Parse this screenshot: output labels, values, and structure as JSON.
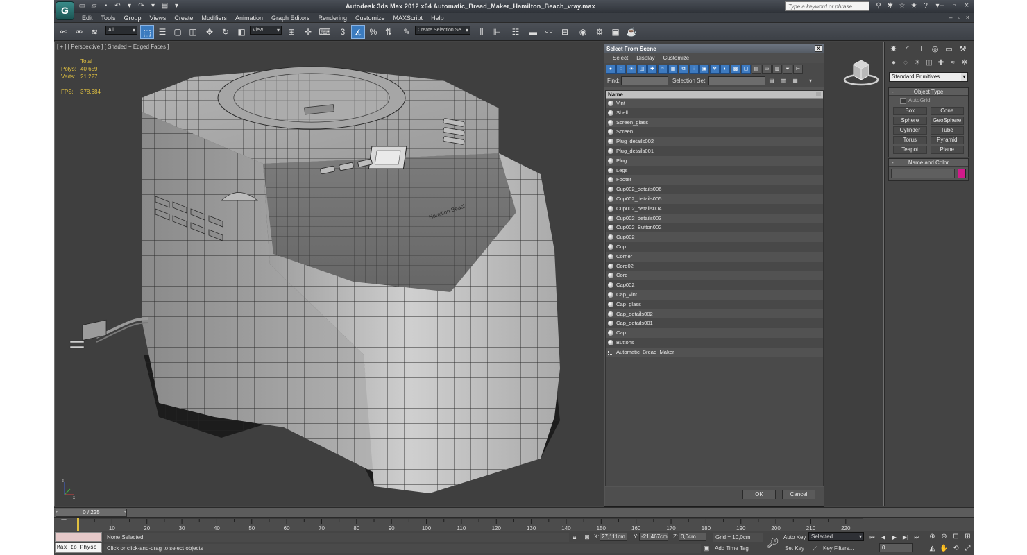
{
  "window": {
    "app_logo": "G",
    "title": "Autodesk 3ds Max  2012 x64     Automatic_Bread_Maker_Hamilton_Beach_vray.max",
    "search_placeholder": "Type a keyword or phrase"
  },
  "menu": [
    "Edit",
    "Tools",
    "Group",
    "Views",
    "Create",
    "Modifiers",
    "Animation",
    "Graph Editors",
    "Rendering",
    "Customize",
    "MAXScript",
    "Help"
  ],
  "toolbar": {
    "selection_filter": "All",
    "reference_coord": "View",
    "snap_label": "3",
    "named_selection": "Create Selection Se"
  },
  "viewport": {
    "label": "[ + ] [ Perspective ] [ Shaded + Edged Faces ]",
    "stats_total": "Total",
    "polys_label": "Polys:",
    "polys_value": "40 659",
    "verts_label": "Verts:",
    "verts_value": "21 227",
    "fps_label": "FPS:",
    "fps_value": "378,684",
    "brand_text": "Hamilton Beach"
  },
  "command_panel": {
    "category": "Standard Primitives",
    "object_type_title": "Object Type",
    "autogrid": "AutoGrid",
    "buttons": [
      "Box",
      "Cone",
      "Sphere",
      "GeoSphere",
      "Cylinder",
      "Tube",
      "Torus",
      "Pyramid",
      "Teapot",
      "Plane"
    ],
    "name_color_title": "Name and Color",
    "color": "#d11a8a"
  },
  "dialog": {
    "title": "Select From Scene",
    "close": "x",
    "menu": [
      "Select",
      "Display",
      "Customize"
    ],
    "find_label": "Find:",
    "selection_set_label": "Selection Set:",
    "column_name": "Name",
    "items": [
      "Vint",
      "Shell",
      "Screen_glass",
      "Screen",
      "Plug_details002",
      "Plug_details001",
      "Plug",
      "Legs",
      "Footer",
      "Cup002_details006",
      "Cup002_details005",
      "Cup002_details004",
      "Cup002_details003",
      "Cup002_Button002",
      "Cup002",
      "Cup",
      "Corner",
      "Cord02",
      "Cord",
      "Cap002",
      "Cap_vint",
      "Cap_glass",
      "Cap_details002",
      "Cap_details001",
      "Cap",
      "Buttons",
      "Automatic_Bread_Maker"
    ],
    "ok": "OK",
    "cancel": "Cancel"
  },
  "timeline": {
    "frame_display": "0 / 225",
    "ticks": [
      "10",
      "20",
      "30",
      "40",
      "50",
      "60",
      "70",
      "80",
      "90",
      "100",
      "110",
      "120",
      "130",
      "140",
      "150",
      "160",
      "170",
      "180",
      "190",
      "200",
      "210",
      "220"
    ]
  },
  "status": {
    "maxscript": "Max to Physc",
    "selection": "None Selected",
    "prompt": "Click or click-and-drag to select objects",
    "x_label": "X:",
    "x_value": "27,111cm",
    "y_label": "Y:",
    "y_value": "-21,467cm",
    "z_label": "Z:",
    "z_value": "0,0cm",
    "grid": "Grid = 10,0cm",
    "add_time_tag": "Add Time Tag",
    "auto_key": "Auto Key",
    "set_key": "Set Key",
    "key_mode": "Selected",
    "key_filters": "Key Filters...",
    "current_frame": "0"
  }
}
